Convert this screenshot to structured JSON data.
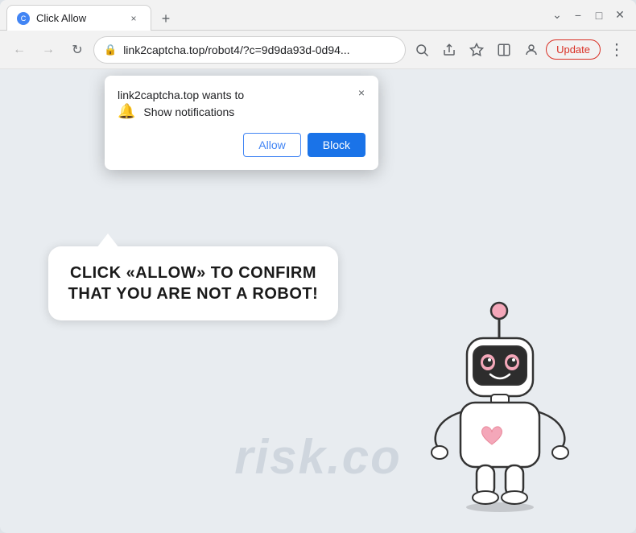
{
  "window": {
    "title": "Click Allow",
    "controls": {
      "minimize": "−",
      "maximize": "□",
      "close": "✕"
    }
  },
  "tab": {
    "favicon_letter": "C",
    "title": "Click Allow",
    "close": "×"
  },
  "new_tab_button": "+",
  "toolbar": {
    "back": "←",
    "forward": "→",
    "refresh": "↻",
    "url": "link2captcha.top/robot4/?c=9d9da93d-0d94...",
    "url_full": "link2captcha.top/robot4/?c=9d9da93d-0d94...",
    "search_icon": "🔍",
    "share_icon": "⬆",
    "bookmark_icon": "☆",
    "split_icon": "⊡",
    "profile_icon": "👤",
    "update_label": "Update",
    "menu_icon": "⋮"
  },
  "notification_popup": {
    "title": "link2captcha.top wants to",
    "close": "×",
    "notification_text": "Show notifications",
    "allow_label": "Allow",
    "block_label": "Block"
  },
  "speech_bubble": {
    "text": "CLICK «ALLOW» TO CONFIRM THAT YOU ARE NOT A ROBOT!"
  },
  "watermark": {
    "text": "risk.co"
  },
  "colors": {
    "allow_blue": "#4285f4",
    "block_blue": "#1a73e8",
    "update_red": "#d93025",
    "background": "#c8d0d8"
  }
}
